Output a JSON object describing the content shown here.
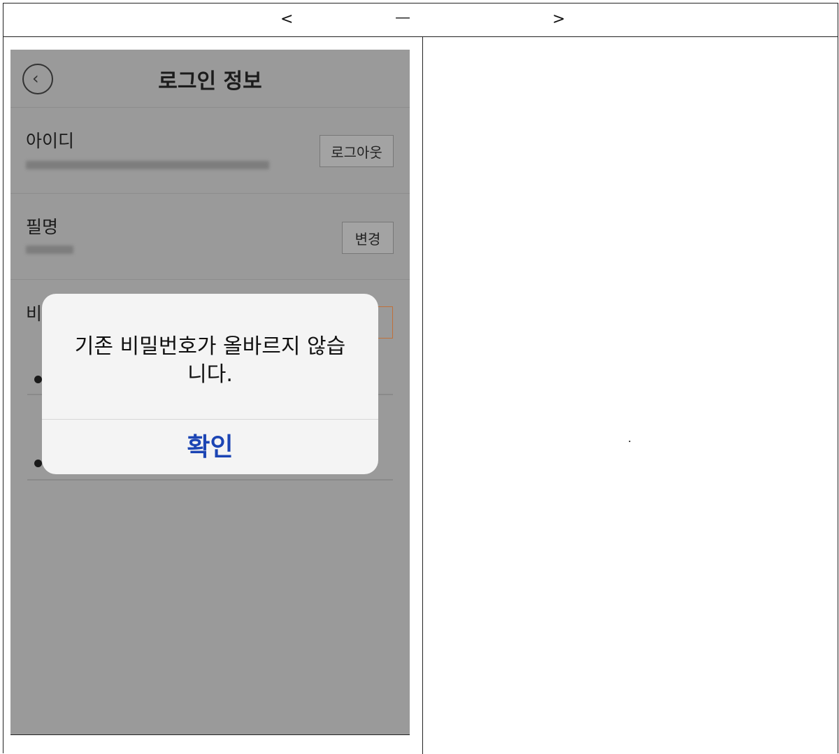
{
  "header": {
    "prev": "<",
    "mid": "—",
    "next": ">"
  },
  "right_panel": {
    "text": "."
  },
  "app": {
    "title": "로그인 정보",
    "back_icon": "chevron-left-icon",
    "sections": {
      "id_label": "아이디",
      "logout_label": "로그아웃",
      "nickname_label": "필명",
      "change_label": "변경",
      "password_label_partial": "비"
    }
  },
  "dialog": {
    "message": "기존 비밀번호가 올바르지 않습\n니다.",
    "ok_label": "확인"
  },
  "colors": {
    "dialog_button": "#1c45b4",
    "accent_orange": "#c0703a"
  }
}
